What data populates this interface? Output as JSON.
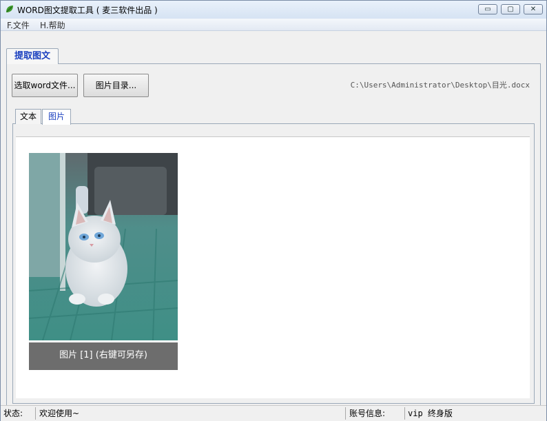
{
  "window": {
    "title": "WORD图文提取工具 ( 麦三软件出品 )",
    "controls": {
      "minimize": "▭",
      "maximize": "▢",
      "close": "✕"
    }
  },
  "menu": {
    "file": "F.文件",
    "help": "H.帮助"
  },
  "main_tab": "提取图文",
  "toolbar": {
    "select_file_button": "选取word文件...",
    "image_dir_button": "图片目录...",
    "file_path": "C:\\Users\\Administrator\\Desktop\\目光.docx"
  },
  "sub_tabs": [
    {
      "label": "文本"
    },
    {
      "label": "图片"
    }
  ],
  "images": [
    {
      "caption": "图片 [1] (右键可另存)"
    }
  ],
  "status": {
    "status_label": "状态:",
    "status_value": "欢迎使用~",
    "account_label": "账号信息:",
    "account_value": "vip 终身版"
  },
  "colors": {
    "active_tab_text": "#1a3fbf",
    "caption_bg": "#6d6d6d"
  }
}
